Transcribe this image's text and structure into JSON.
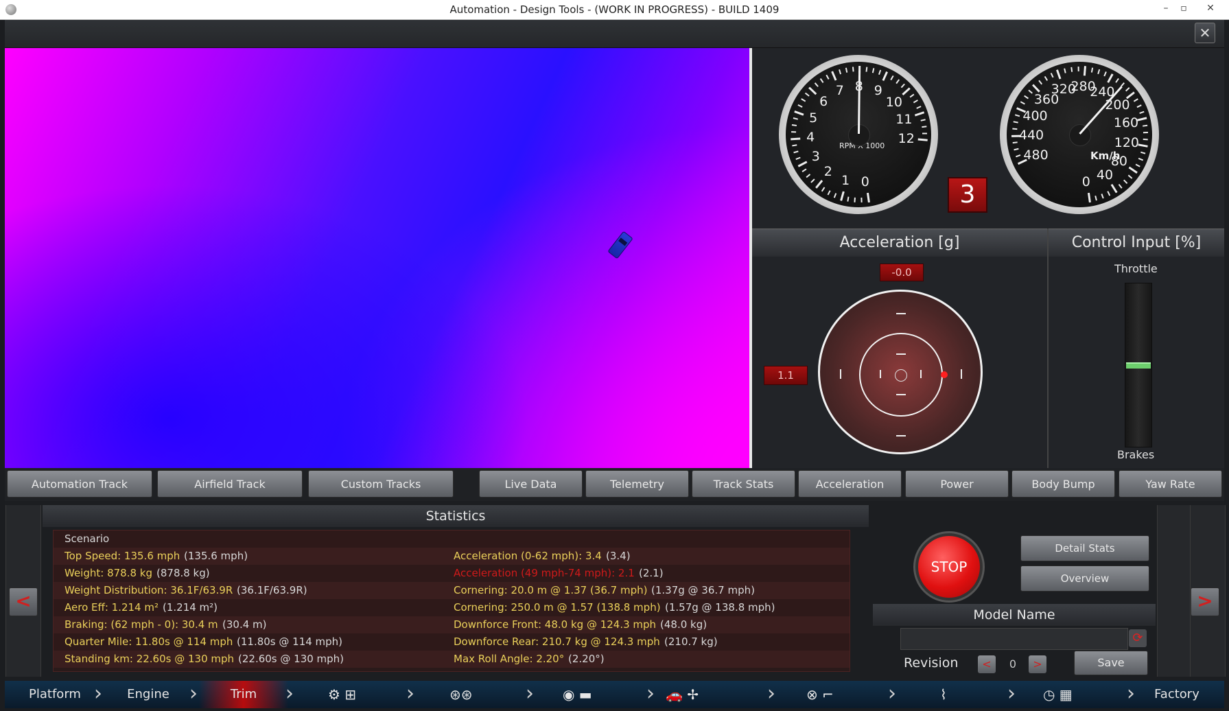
{
  "window": {
    "title": "Automation - Design Tools - (WORK IN PROGRESS) - BUILD 1409"
  },
  "toolbar": {
    "close_glyph": "✕"
  },
  "rpm_gauge": {
    "numbers": [
      "0",
      "1",
      "2",
      "3",
      "4",
      "5",
      "6",
      "7",
      "8",
      "9",
      "10",
      "11",
      "12"
    ],
    "caption": "RPM X 1000",
    "value_rpm_x1000": 8.0
  },
  "speed_gauge": {
    "numbers": [
      "0",
      "40",
      "80",
      "120",
      "160",
      "200",
      "240",
      "280",
      "320",
      "360",
      "400",
      "440",
      "480"
    ],
    "unit": "Km/h",
    "value_kmh": 218
  },
  "gear": {
    "value": "3"
  },
  "acceleration": {
    "title": "Acceleration [g]",
    "longitudinal": "-0.0",
    "lateral": "1.1"
  },
  "control_input": {
    "title": "Control Input [%]",
    "throttle_label": "Throttle",
    "brakes_label": "Brakes",
    "throttle_fraction": 0.5
  },
  "tabs": {
    "track_tabs": [
      "Automation Track",
      "Airfield Track",
      "Custom Tracks"
    ],
    "data_tabs": [
      "Live Data",
      "Telemetry",
      "Track Stats",
      "Acceleration",
      "Power",
      "Body Bump",
      "Yaw Rate"
    ]
  },
  "statistics": {
    "title": "Statistics",
    "scenario": "Scenario",
    "left": [
      {
        "label": "Top Speed: 135.6 mph",
        "value": "(135.6 mph)",
        "color": "yellow"
      },
      {
        "label": "Weight: 878.8 kg",
        "value": "(878.8 kg)",
        "color": "yellow"
      },
      {
        "label": "Weight Distribution: 36.1F/63.9R",
        "value": "(36.1F/63.9R)",
        "color": "yellow"
      },
      {
        "label": "Aero Eff: 1.214 m²",
        "value": "(1.214 m²)",
        "color": "yellow"
      },
      {
        "label": "Braking: (62 mph - 0): 30.4 m",
        "value": "(30.4 m)",
        "color": "yellow"
      },
      {
        "label": "Quarter Mile: 11.80s @ 114 mph",
        "value": "(11.80s @ 114 mph)",
        "color": "yellow"
      },
      {
        "label": "Standing km: 22.60s @ 130 mph",
        "value": "(22.60s @ 130 mph)",
        "color": "yellow"
      }
    ],
    "right": [
      {
        "label": "Acceleration (0-62 mph): 3.4",
        "value": "(3.4)",
        "color": "yellow"
      },
      {
        "label": "Acceleration (49 mph-74 mph): 2.1",
        "value": "(2.1)",
        "color": "red"
      },
      {
        "label": "Cornering: 20.0 m @ 1.37 (36.7 mph)",
        "value": "(1.37g @ 36.7 mph)",
        "color": "yellow"
      },
      {
        "label": "Cornering: 250.0 m @ 1.57 (138.8 mph)",
        "value": "(1.57g @ 138.8 mph)",
        "color": "yellow"
      },
      {
        "label": "Downforce Front: 48.0 kg @ 124.3 mph",
        "value": "(48.0 kg)",
        "color": "yellow"
      },
      {
        "label": "Downforce Rear: 210.7 kg @ 124.3 mph",
        "value": "(210.7 kg)",
        "color": "yellow"
      },
      {
        "label": "Max Roll Angle: 2.20°",
        "value": "(2.20°)",
        "color": "yellow"
      }
    ]
  },
  "controls": {
    "stop_label": "STOP",
    "detail_stats": "Detail Stats",
    "overview": "Overview",
    "model_name_title": "Model Name",
    "model_name_value": "",
    "revision_label": "Revision",
    "revision_value": "0",
    "save_label": "Save",
    "prev_glyph": "<",
    "next_glyph": ">"
  },
  "bottom_nav": {
    "platform": "Platform",
    "engine": "Engine",
    "trim": "Trim",
    "factory": "Factory",
    "icons": [
      "gear-shift-icon",
      "wheels-icon",
      "body-icon",
      "car-fan-icon",
      "interior-icon",
      "suspension-icon",
      "test-track-icon"
    ]
  },
  "colors": {
    "accent_red": "#d01a1a",
    "stat_yellow": "#ead05a",
    "viewport_magenta": "#ff00ff",
    "viewport_blue": "#2a10ff"
  }
}
